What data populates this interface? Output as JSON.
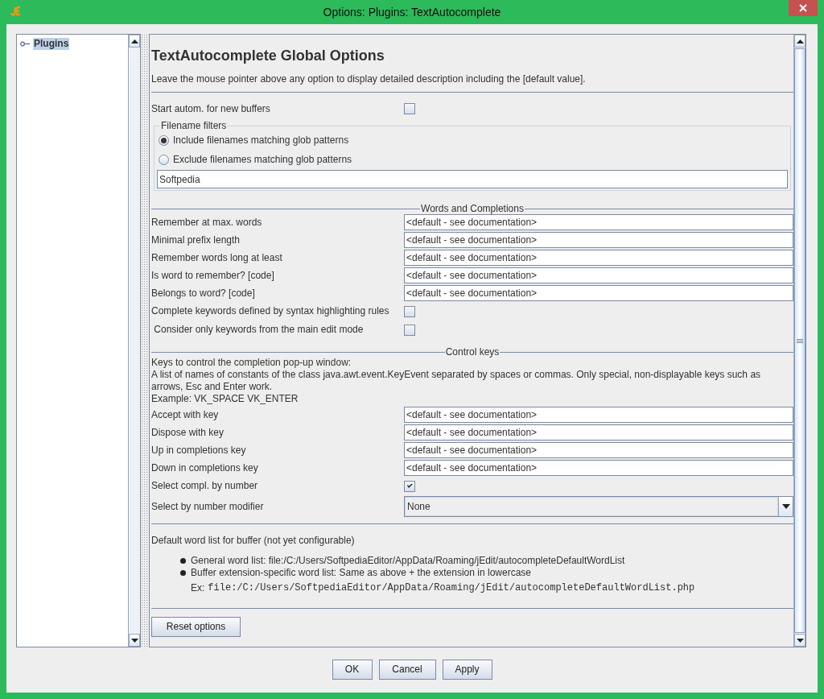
{
  "window": {
    "title": "Options: Plugins: TextAutocomplete"
  },
  "tree": {
    "items": [
      {
        "label": "Plugins",
        "selected": true
      }
    ]
  },
  "pane": {
    "heading": "TextAutocomplete Global Options",
    "intro": "Leave the mouse pointer above any option to display detailed description including the [default value].",
    "start_option": {
      "label": "Start autom. for new buffers",
      "checked": false
    },
    "filename_filters": {
      "title": "Filename filters",
      "options": [
        {
          "label": "Include filenames matching glob patterns",
          "selected": true
        },
        {
          "label": "Exclude filenames matching glob patterns",
          "selected": false
        }
      ],
      "pattern": "Softpedia"
    },
    "sections": [
      {
        "title": "Words and Completions",
        "rows": [
          {
            "kind": "text",
            "label": "Remember at max. words",
            "value": "<default - see documentation>"
          },
          {
            "kind": "text",
            "label": "Minimal prefix length",
            "value": "<default - see documentation>"
          },
          {
            "kind": "text",
            "label": "Remember words long at least",
            "value": "<default - see documentation>"
          },
          {
            "kind": "text",
            "label": "Is word to remember? [code]",
            "value": "<default - see documentation>"
          },
          {
            "kind": "text",
            "label": "Belongs to word? [code]",
            "value": "<default - see documentation>"
          },
          {
            "kind": "checkbox",
            "label": "Complete keywords defined by syntax highlighting rules",
            "checked": false
          },
          {
            "kind": "checkbox",
            "label": " Consider only keywords from the main edit mode",
            "checked": false
          }
        ]
      },
      {
        "title": "Control keys",
        "description": [
          "Keys to control the completion pop-up window:",
          "A list of names of constants of the class java.awt.event.KeyEvent separated by spaces or commas. Only special, non-displayable keys such as arrows, Esc and Enter work.",
          "Example: VK_SPACE VK_ENTER"
        ],
        "rows": [
          {
            "kind": "text",
            "label": "Accept with key",
            "value": "<default - see documentation>"
          },
          {
            "kind": "text",
            "label": "Dispose with key",
            "value": "<default - see documentation>"
          },
          {
            "kind": "text",
            "label": "Up in completions key",
            "value": "<default - see documentation>"
          },
          {
            "kind": "text",
            "label": "Down in completions key",
            "value": "<default - see documentation>"
          },
          {
            "kind": "checkbox",
            "label": "Select compl. by number",
            "checked": true
          },
          {
            "kind": "select",
            "label": "Select by number modifier",
            "value": "None"
          }
        ]
      }
    ],
    "word_list": {
      "heading": "Default word list for buffer (not yet configurable)",
      "bullets": [
        {
          "text": "General word list: file:/C:/Users/SoftpediaEditor/AppData/Roaming/jEdit/autocompleteDefaultWordList"
        },
        {
          "text": "Buffer extension-specific word list: Same as above + the extension in lowercase",
          "example_label": "Ex:",
          "example_path": "file:/C:/Users/SoftpediaEditor/AppData/Roaming/jEdit/autocompleteDefaultWordList.php"
        }
      ]
    },
    "reset_button": "Reset options"
  },
  "buttons": [
    "OK",
    "Cancel",
    "Apply"
  ]
}
